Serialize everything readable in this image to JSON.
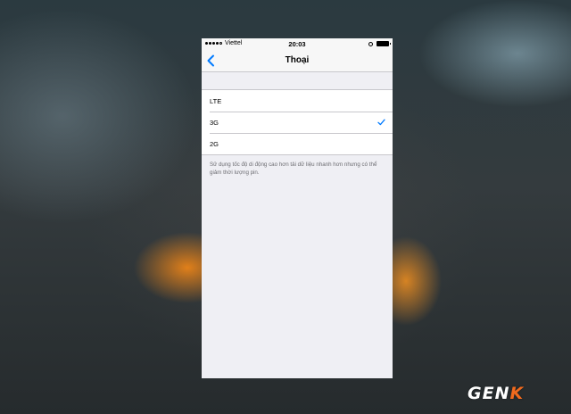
{
  "status_bar": {
    "carrier": "Viettel",
    "time": "20:03",
    "signal_icon": "signal-dots-icon",
    "battery_icon": "battery-icon"
  },
  "nav": {
    "back_icon": "chevron-left-icon",
    "title": "Thoại"
  },
  "options": {
    "items": [
      {
        "label": "LTE",
        "selected": false
      },
      {
        "label": "3G",
        "selected": true
      },
      {
        "label": "2G",
        "selected": false
      }
    ]
  },
  "footer_note": "Sử dụng tốc độ di động cao hơn tải dữ liệu nhanh hơn nhưng có thể giảm thời lượng pin.",
  "watermark": {
    "text_main": "GEN",
    "text_accent": "K"
  },
  "colors": {
    "accent": "#007aff",
    "logo_accent": "#f06a1e"
  }
}
